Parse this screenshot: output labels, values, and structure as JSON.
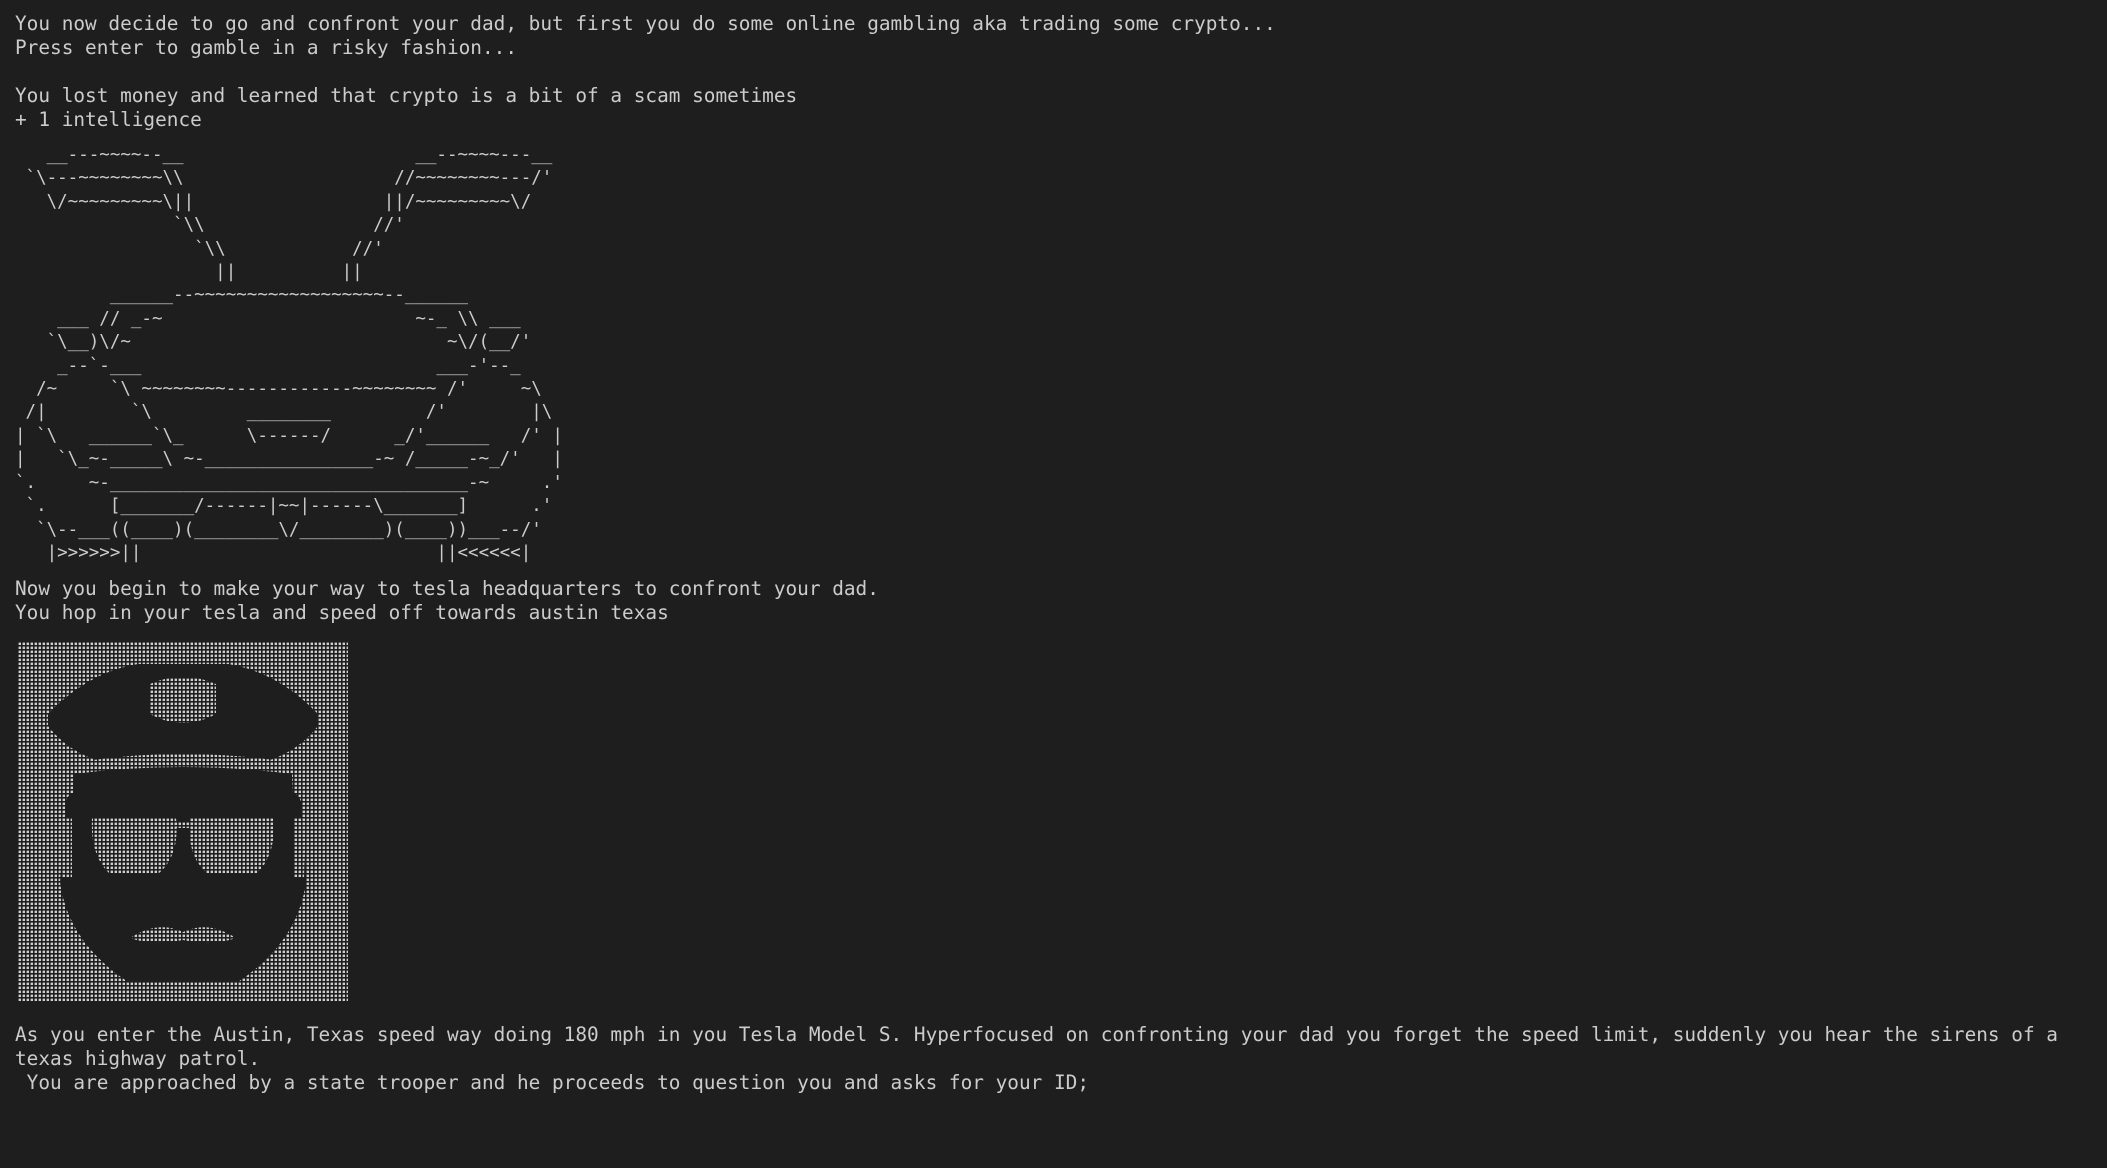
{
  "terminal": {
    "line1": "You now decide to go and confront your dad, but first you do some online gambling aka trading some crypto...",
    "line2": "Press enter to gamble in a risky fashion...",
    "line3": "You lost money and learned that crypto is a bit of a scam sometimes",
    "line4": "+ 1 intelligence",
    "car_art": "   __---~~~~--__                      __--~~~~---__\n `\\---~~~~~~~~\\\\                    //~~~~~~~~---/'\n   \\/~~~~~~~~~\\||                  ||/~~~~~~~~~\\/\n               `\\\\                //'\n                 `\\\\            //'\n                   ||          ||\n         ______--~~~~~~~~~~~~~~~~~~--______\n    ___ // _-~                        ~-_ \\\\ ___\n   `\\__)\\/~                              ~\\/(__/'\n    _--`-___                            ___-'--_\n  /~     `\\ ~~~~~~~~------------~~~~~~~~ /'     ~\\\n /|        `\\         ________         /'        |\\\n| `\\   ______`\\_      \\------/      _/'______   /' |\n|   `\\_~-_____\\ ~-________________-~ /_____-~_/'   |\n`.     ~-__________________________________-~     .'\n `.      [_______/------|~~|------\\_______]      .'\n  `\\--___((____)(________\\/________)(____))___--/'\n   |>>>>>>||                            ||<<<<<<|",
    "line5": "Now you begin to make your way to tesla headquarters to confront your dad.",
    "line6": "You hop in your tesla and speed off towards austin texas",
    "line7": "As you enter the Austin, Texas speed way doing 180 mph in you Tesla Model S. Hyperfocused on confronting your dad you forget the speed limit, suddenly you hear the sirens of a texas highway patrol.",
    "line8": " You are approached by a state trooper and he proceeds to question you and asks for your ID;"
  },
  "colors": {
    "background": "#1e1e1e",
    "text": "#cccccc"
  },
  "icons": {
    "trooper": "police-trooper-ascii-art"
  }
}
